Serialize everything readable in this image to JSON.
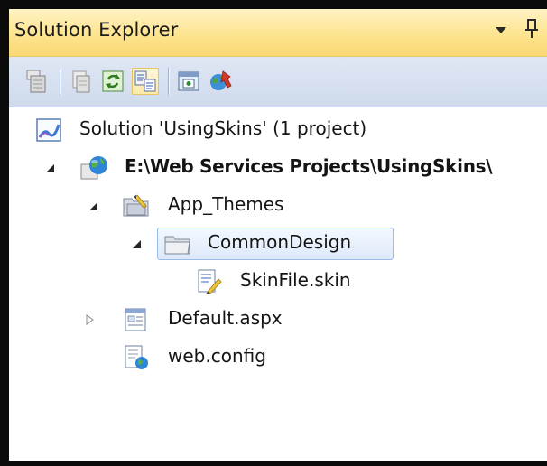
{
  "window": {
    "title": "Solution Explorer"
  },
  "toolbar": {
    "buttons": [
      {
        "name": "show-all-files"
      },
      {
        "name": "properties"
      },
      {
        "name": "refresh"
      },
      {
        "name": "view-code",
        "pressed": true
      },
      {
        "name": "view-designer"
      },
      {
        "name": "copy-website"
      }
    ]
  },
  "tree": {
    "solution": {
      "label": "Solution 'UsingSkins' (1 project)",
      "icon": "solution-icon"
    },
    "project": {
      "label": "E:\\Web Services Projects\\UsingSkins\\",
      "icon": "web-project-icon",
      "expanded": true
    },
    "app_themes": {
      "label": "App_Themes",
      "icon": "themes-folder-icon",
      "expanded": true
    },
    "common_design": {
      "label": "CommonDesign",
      "icon": "folder-icon",
      "expanded": true,
      "selected": true
    },
    "skin_file": {
      "label": "SkinFile.skin",
      "icon": "skin-file-icon"
    },
    "default_aspx": {
      "label": "Default.aspx",
      "icon": "aspx-page-icon",
      "expanded": false
    },
    "web_config": {
      "label": "web.config",
      "icon": "config-file-icon"
    }
  },
  "colors": {
    "title_bar": "#fde48f",
    "toolbar": "#cfdaec",
    "selection": "#dde9fb",
    "frame": "#0a0a0a"
  }
}
